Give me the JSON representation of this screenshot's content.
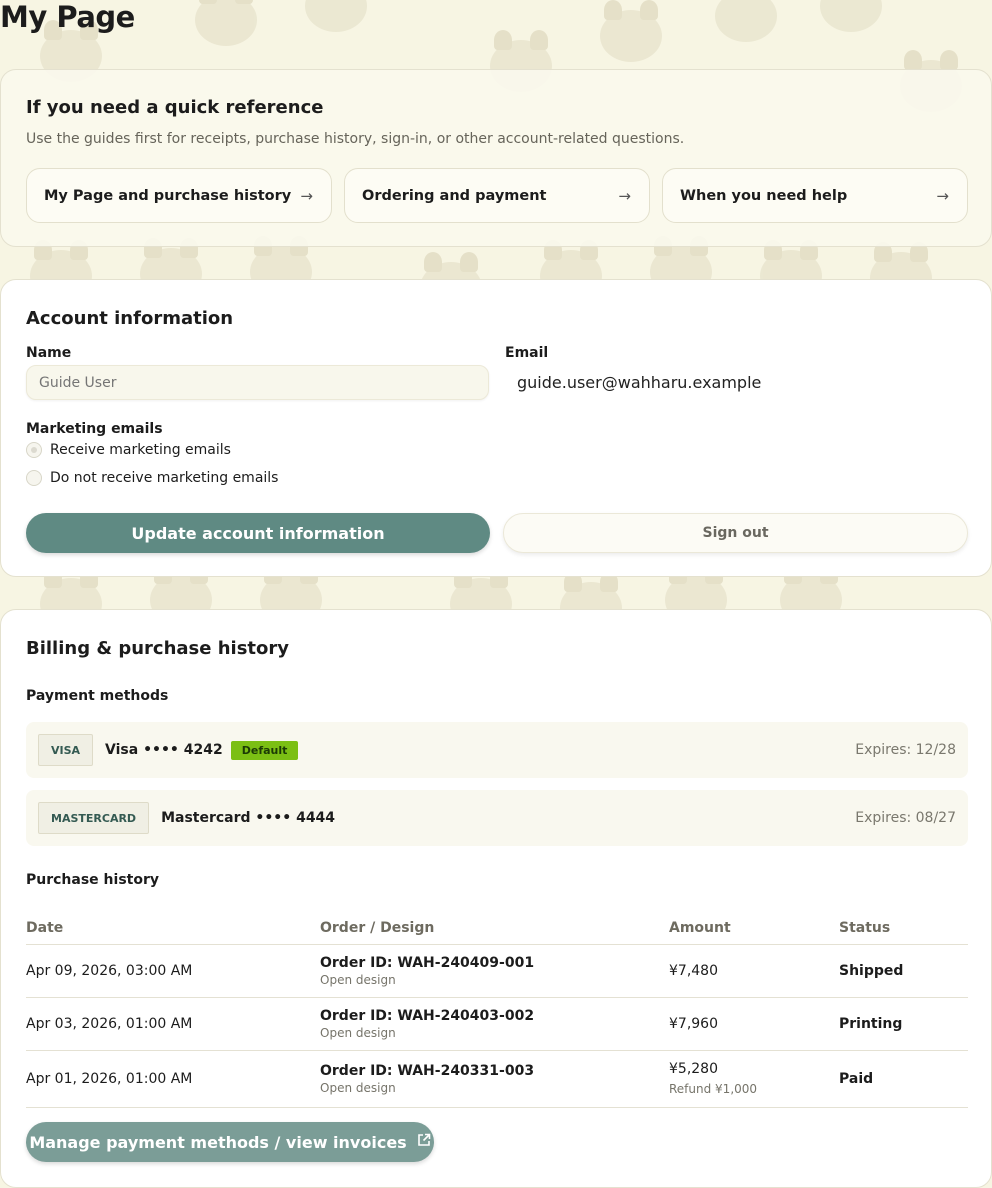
{
  "page": {
    "title": "My Page"
  },
  "reference": {
    "heading": "If you need a quick reference",
    "description": "Use the guides first for receipts, purchase history, sign-in, or other account-related questions.",
    "guides": [
      {
        "label": "My Page and purchase history",
        "arrow": "→"
      },
      {
        "label": "Ordering and payment",
        "arrow": "→"
      },
      {
        "label": "When you need help",
        "arrow": "→"
      }
    ]
  },
  "account": {
    "heading": "Account information",
    "name_label": "Name",
    "name_placeholder": "Guide User",
    "email_label": "Email",
    "email_value": "guide.user@wahharu.example",
    "marketing_label": "Marketing emails",
    "options": [
      {
        "label": "Receive marketing emails",
        "checked": true
      },
      {
        "label": "Do not receive marketing emails",
        "checked": false
      }
    ],
    "update_button": "Update account information",
    "signout_button": "Sign out"
  },
  "billing": {
    "heading": "Billing & purchase history",
    "payment_methods_label": "Payment methods",
    "payment_methods": [
      {
        "brand": "VISA",
        "label": "Visa •••• 4242",
        "default_badge": "Default",
        "expiry": "Expires: 12/28"
      },
      {
        "brand": "MASTERCARD",
        "label": "Mastercard •••• 4444",
        "expiry": "Expires: 08/27"
      }
    ],
    "history_label": "Purchase history",
    "columns": [
      "Date",
      "Order / Design",
      "Amount",
      "Status"
    ],
    "rows": [
      {
        "date": "Apr 09, 2026, 03:00 AM",
        "order_id": "Order ID: WAH-240409-001",
        "design_link": "Open design",
        "amount": "¥7,480",
        "status": "Shipped"
      },
      {
        "date": "Apr 03, 2026, 01:00 AM",
        "order_id": "Order ID: WAH-240403-002",
        "design_link": "Open design",
        "amount": "¥7,960",
        "status": "Printing"
      },
      {
        "date": "Apr 01, 2026, 01:00 AM",
        "order_id": "Order ID: WAH-240331-003",
        "design_link": "Open design",
        "amount": "¥5,280",
        "refund": "Refund ¥1,000",
        "status": "Paid"
      }
    ],
    "manage_button": "Manage payment methods / view invoices",
    "manage_icon": "external-link-icon"
  },
  "colors": {
    "background": "#f7f5e3",
    "primary_button": "#5f8a83",
    "manage_button": "#7b9d97",
    "default_badge": "#7bbf14"
  }
}
